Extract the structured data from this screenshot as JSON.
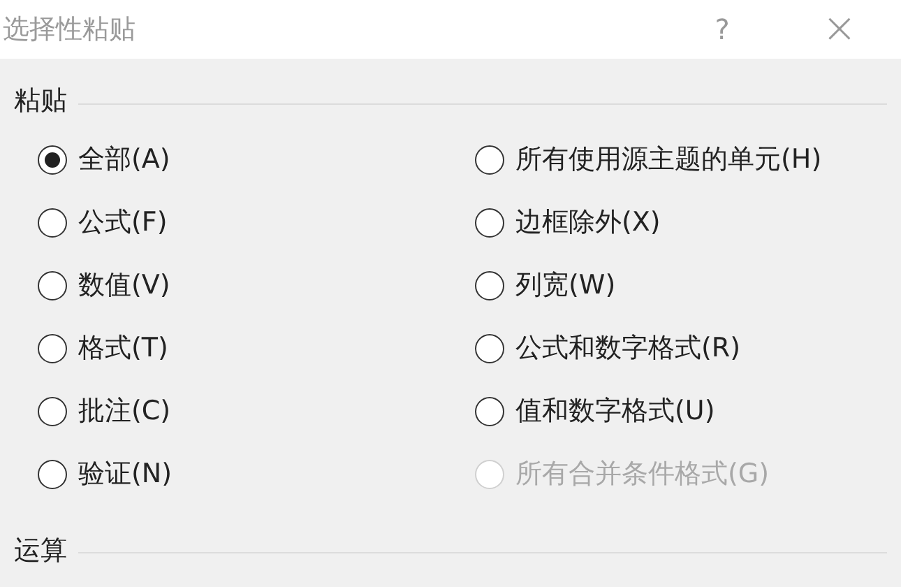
{
  "window": {
    "title": "选择性粘贴",
    "help": "?",
    "close": "×"
  },
  "sections": [
    {
      "title": "粘贴",
      "options": [
        {
          "label": "全部(A)",
          "selected": true,
          "disabled": false
        },
        {
          "label": "公式(F)",
          "selected": false,
          "disabled": false
        },
        {
          "label": "数值(V)",
          "selected": false,
          "disabled": false
        },
        {
          "label": "格式(T)",
          "selected": false,
          "disabled": false
        },
        {
          "label": "批注(C)",
          "selected": false,
          "disabled": false
        },
        {
          "label": "验证(N)",
          "selected": false,
          "disabled": false
        },
        {
          "label": "所有使用源主题的单元(H)",
          "selected": false,
          "disabled": false
        },
        {
          "label": "边框除外(X)",
          "selected": false,
          "disabled": false
        },
        {
          "label": "列宽(W)",
          "selected": false,
          "disabled": false
        },
        {
          "label": "公式和数字格式(R)",
          "selected": false,
          "disabled": false
        },
        {
          "label": "值和数字格式(U)",
          "selected": false,
          "disabled": false
        },
        {
          "label": "所有合并条件格式(G)",
          "selected": false,
          "disabled": true
        }
      ]
    },
    {
      "title": "运算"
    }
  ]
}
